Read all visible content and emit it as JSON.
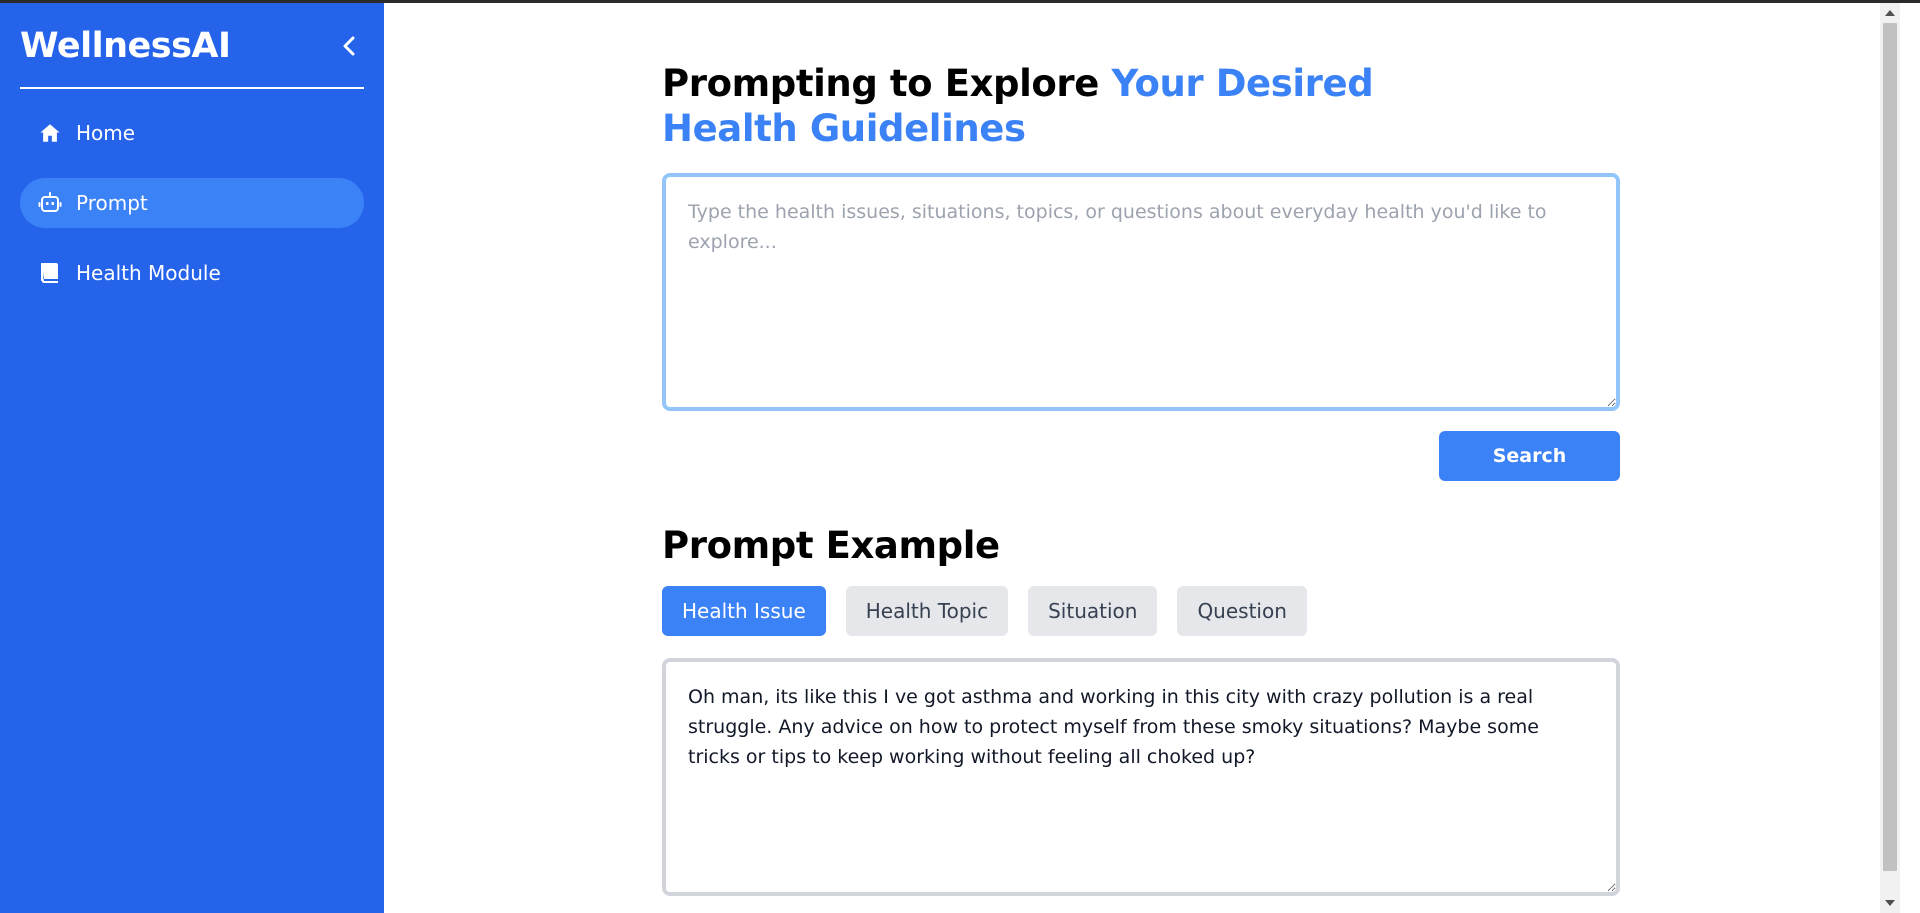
{
  "sidebar": {
    "brand": "WellnessAI",
    "items": [
      {
        "label": "Home",
        "icon": "home-icon",
        "active": false
      },
      {
        "label": "Prompt",
        "icon": "robot-icon",
        "active": true
      },
      {
        "label": "Health Module",
        "icon": "book-icon",
        "active": false
      }
    ]
  },
  "main": {
    "title_part1": "Prompting to Explore ",
    "title_part2": "Your Desired Health Guidelines",
    "prompt": {
      "placeholder": "Type the health issues, situations, topics, or questions about everyday health you'd like to explore...",
      "value": ""
    },
    "search_label": "Search",
    "example_title": "Prompt Example",
    "tabs": [
      {
        "label": "Health Issue",
        "active": true
      },
      {
        "label": "Health Topic",
        "active": false
      },
      {
        "label": "Situation",
        "active": false
      },
      {
        "label": "Question",
        "active": false
      }
    ],
    "example_text": "Oh man, its like this I ve got asthma and working in this city with crazy pollution is a real struggle. Any advice on how to protect myself from these smoky situations? Maybe some tricks or tips to keep working without feeling all choked up?"
  },
  "colors": {
    "sidebar_bg": "#2563eb",
    "accent": "#3b82f6",
    "active_nav": "#3b82f6",
    "tab_inactive": "#e5e7eb",
    "prompt_border": "#93c5fd"
  }
}
